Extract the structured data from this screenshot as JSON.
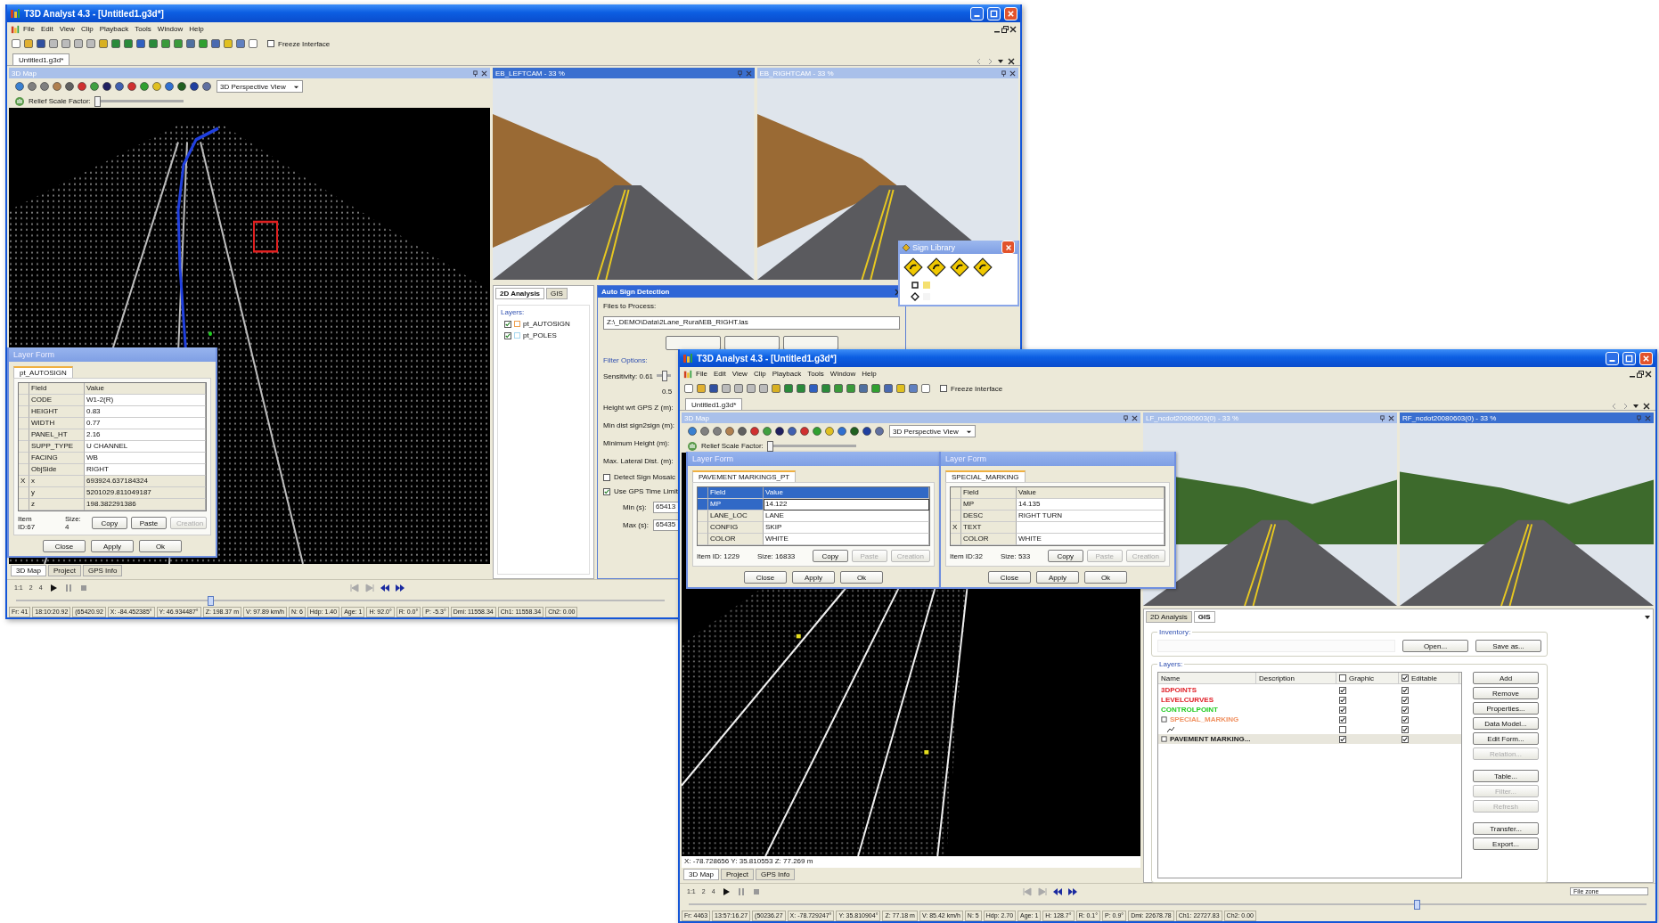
{
  "windows": [
    {
      "title": "T3D Analyst 4.3 - [Untitled1.g3d*]",
      "menu": [
        "File",
        "Edit",
        "View",
        "Clip",
        "Playback",
        "Tools",
        "Window",
        "Help"
      ],
      "freeze_interface": {
        "label": "Freeze Interface",
        "checked": false
      },
      "document_tab": "Untitled1.g3d*",
      "map_panel": {
        "title": "3D Map",
        "active": false,
        "view_mode": "3D Perspective View",
        "relief": {
          "label": "Relief Scale Factor:",
          "level": 0
        }
      },
      "camera_panels": [
        {
          "title": "EB_LEFTCAM - 33 %",
          "active": true
        },
        {
          "title": "EB_RIGHTCAM - 33 %",
          "active": false
        }
      ],
      "layer_forms": [
        {
          "title": "Layer Form",
          "layer": "pt_AUTOSIGN",
          "active": false,
          "columns": [
            "Field",
            "Value"
          ],
          "rows": [
            {
              "field": "CODE",
              "value": "W1-2(R)",
              "selected": false,
              "read_only": false
            },
            {
              "field": "HEIGHT",
              "value": "0.83",
              "selected": false,
              "read_only": false
            },
            {
              "field": "WIDTH",
              "value": "0.77",
              "selected": false,
              "read_only": false
            },
            {
              "field": "PANEL_HT",
              "value": "2.16",
              "selected": false,
              "read_only": false
            },
            {
              "field": "SUPP_TYPE",
              "value": "U CHANNEL",
              "selected": false,
              "read_only": false
            },
            {
              "field": "FACING",
              "value": "WB",
              "selected": false,
              "read_only": false
            },
            {
              "field": "ObjSide",
              "value": "RIGHT",
              "selected": false,
              "read_only": false
            },
            {
              "marker": "X",
              "field": "x",
              "value": "693924.637184324",
              "selected": false,
              "read_only": true
            },
            {
              "field": "y",
              "value": "5201029.811049187",
              "selected": false,
              "read_only": true
            },
            {
              "field": "z",
              "value": "198.382291386",
              "selected": false,
              "read_only": true
            }
          ],
          "item_id": "Item ID:67",
          "size": "Size: 4",
          "edit_buttons": [
            {
              "label": "Copy",
              "disabled": false
            },
            {
              "label": "Paste",
              "disabled": false
            },
            {
              "label": "Creation",
              "disabled": true
            }
          ],
          "buttons": [
            "Close",
            "Apply",
            "Ok"
          ]
        }
      ],
      "bottom_tabs": [
        {
          "label": "3D Map",
          "selected": true
        },
        {
          "label": "Project",
          "selected": false
        },
        {
          "label": "GPS Info",
          "selected": false
        }
      ],
      "speed_labels": [
        "1:1",
        "2",
        "4"
      ],
      "seek_slider": {
        "level": 0.3
      },
      "status_bar": [
        "Fr: 41",
        "18:10:20.92",
        "(65420.92",
        "X: -84.452385°",
        "Y: 46.934487°",
        "Z: 198.37 m",
        "V: 97.89 km/h",
        "N: 6",
        "Hdp: 1.40",
        "Age: 1",
        "H: 92.0°",
        "R: 0.0°",
        "P: -5.3°",
        "Dmi: 11558.34",
        "Ch1: 11558.34",
        "Ch2: 0.00"
      ],
      "analysis_panel": {
        "tabs": [
          {
            "label": "2D Analysis",
            "selected": true
          },
          {
            "label": "GIS",
            "selected": false
          }
        ],
        "layers_label": "Layers:",
        "layers": [
          {
            "name": "pt_AUTOSIGN",
            "checked": true,
            "color": "#f0a050"
          },
          {
            "name": "pt_POLES",
            "checked": true,
            "color": "#a8d8f0"
          }
        ]
      },
      "auto_sign_detection": {
        "title": "Auto Sign Detection",
        "files_label": "Files to Process:",
        "file_path": "Z:\\_DEMO\\Data\\2Lane_Rural\\EB_RIGHT.las",
        "filter_label": "Filter Options:",
        "sensitivity": {
          "label": "Sensitivity: 0.61",
          "level": 0.5,
          "tick": "0.5"
        },
        "params": [
          "Height wrt GPS Z (m):",
          "Min dist sign2sign (m):",
          "Minimum Height (m):",
          "Max. Lateral Dist. (m):"
        ],
        "checks": [
          {
            "label": "Detect Sign Mosaic",
            "checked": false
          },
          {
            "label": "Use GPS Time Limit",
            "checked": true
          }
        ],
        "time_limits": [
          {
            "label": "Min (s):",
            "value": "65413"
          },
          {
            "label": "Max (s):",
            "value": "65435"
          }
        ]
      },
      "sign_library": {
        "title": "Sign Library"
      }
    },
    {
      "title": "T3D Analyst 4.3 - [Untitled1.g3d*]",
      "menu": [
        "File",
        "Edit",
        "View",
        "Clip",
        "Playback",
        "Tools",
        "Window",
        "Help"
      ],
      "freeze_interface": {
        "label": "Freeze Interface",
        "checked": false
      },
      "document_tab": "Untitled1.g3d*",
      "map_panel": {
        "title": "3D Map",
        "active": false,
        "view_mode": "3D Perspective View",
        "relief": {
          "label": "Relief Scale Factor:",
          "level": 0
        },
        "coordinates": "X: -78.728656  Y: 35.810553  Z: 77.269 m"
      },
      "camera_panels": [
        {
          "title": "LF_ncdot20080603(0) - 33 %",
          "active": false
        },
        {
          "title": "RF_ncdot20080603(0) - 33 %",
          "active": true
        }
      ],
      "layer_forms": [
        {
          "title": "Layer Form",
          "layer": "PAVEMENT MARKINGS_PT",
          "active": true,
          "columns": [
            "Field",
            "Value"
          ],
          "rows": [
            {
              "field": "MP",
              "value": "14.122",
              "selected": true,
              "read_only": false
            },
            {
              "field": "LANE_LOC",
              "value": "LANE",
              "selected": false,
              "read_only": false
            },
            {
              "field": "CONFIG",
              "value": "SKIP",
              "selected": false,
              "read_only": false
            },
            {
              "field": "COLOR",
              "value": "WHITE",
              "selected": false,
              "read_only": false
            }
          ],
          "item_id": "Item ID: 1229",
          "size": "Size: 16833",
          "edit_buttons": [
            {
              "label": "Copy",
              "disabled": false
            },
            {
              "label": "Paste",
              "disabled": true
            },
            {
              "label": "Creation",
              "disabled": true
            }
          ],
          "buttons": [
            "Close",
            "Apply",
            "Ok"
          ]
        },
        {
          "title": "Layer Form",
          "layer": "SPECIAL_MARKING",
          "active": false,
          "columns": [
            "Field",
            "Value"
          ],
          "rows": [
            {
              "field": "MP",
              "value": "14.135",
              "selected": false,
              "read_only": false
            },
            {
              "field": "DESC",
              "value": "RIGHT TURN",
              "selected": false,
              "read_only": false
            },
            {
              "marker": "X",
              "field": "TEXT",
              "selected": false,
              "read_only": false
            },
            {
              "field": "COLOR",
              "value": "WHITE",
              "selected": false,
              "read_only": false
            }
          ],
          "item_id": "Item ID:32",
          "size": "Size: 533",
          "edit_buttons": [
            {
              "label": "Copy",
              "disabled": false
            },
            {
              "label": "Paste",
              "disabled": true
            },
            {
              "label": "Creation",
              "disabled": true
            }
          ],
          "buttons": [
            "Close",
            "Apply",
            "Ok"
          ]
        }
      ],
      "bottom_tabs": [
        {
          "label": "3D Map",
          "selected": true
        },
        {
          "label": "Project",
          "selected": false
        },
        {
          "label": "GPS Info",
          "selected": false
        }
      ],
      "speed_labels": [
        "1:1",
        "2",
        "4"
      ],
      "seek_slider": {
        "level": 0.76
      },
      "file_zone": "File zone",
      "status_bar": [
        "Fr: 4463",
        "13:57:16.27",
        "(50236.27",
        "X: -78.729247°",
        "Y: 35.810904°",
        "Z: 77.18 m",
        "V: 85.42 km/h",
        "N: 5",
        "Hdp: 2.70",
        "Age: 1",
        "H: 128.7°",
        "R: 0.1°",
        "P: 0.9°",
        "Dmi: 22678.78",
        "Ch1: 22727.83",
        "Ch2: 0.00"
      ],
      "gis_panel": {
        "tabs": [
          {
            "label": "2D Analysis",
            "selected": false
          },
          {
            "label": "GIS",
            "selected": true
          }
        ],
        "inventory_label": "Inventory:",
        "inventory_buttons": [
          "Open...",
          "Save as..."
        ],
        "layers_label": "Layers:",
        "columns": [
          "Name",
          "Description",
          "Graphic",
          "Editable"
        ],
        "header_checks": {
          "graphic": false,
          "editable": true
        },
        "rows": [
          {
            "kind": "layer",
            "name": "3DPOINTS",
            "color": "#e02028",
            "graphic": true,
            "editable": true,
            "selected": false
          },
          {
            "kind": "layer",
            "name": "LEVELCURVES",
            "color": "#e02028",
            "graphic": true,
            "editable": true,
            "selected": false
          },
          {
            "kind": "layer",
            "name": "CONTROLPOINT",
            "color": "#22cc22",
            "graphic": true,
            "editable": true,
            "selected": false
          },
          {
            "kind": "group",
            "name": "SPECIAL_MARKING",
            "color": "#f09060",
            "graphic": true,
            "editable": true,
            "selected": false,
            "children": [
              {
                "kind": "line",
                "graphic": false,
                "editable": true,
                "selected": false
              }
            ]
          },
          {
            "kind": "group",
            "name": "PAVEMENT MARKING...",
            "color": "#202020",
            "graphic": true,
            "editable": true,
            "selected": true
          }
        ],
        "buttons": [
          {
            "label": "Add",
            "disabled": false
          },
          {
            "label": "Remove",
            "disabled": false
          },
          {
            "label": "Properties...",
            "disabled": false
          },
          {
            "label": "Data Model...",
            "disabled": false
          },
          {
            "label": "Edit Form...",
            "disabled": false
          },
          {
            "label": "Relation...",
            "disabled": true
          },
          {
            "label": "Table...",
            "disabled": false
          },
          {
            "label": "Filter...",
            "disabled": true
          },
          {
            "label": "Refresh",
            "disabled": true
          },
          {
            "label": "Transfer...",
            "disabled": false
          },
          {
            "label": "Export...",
            "disabled": false
          }
        ]
      }
    }
  ]
}
